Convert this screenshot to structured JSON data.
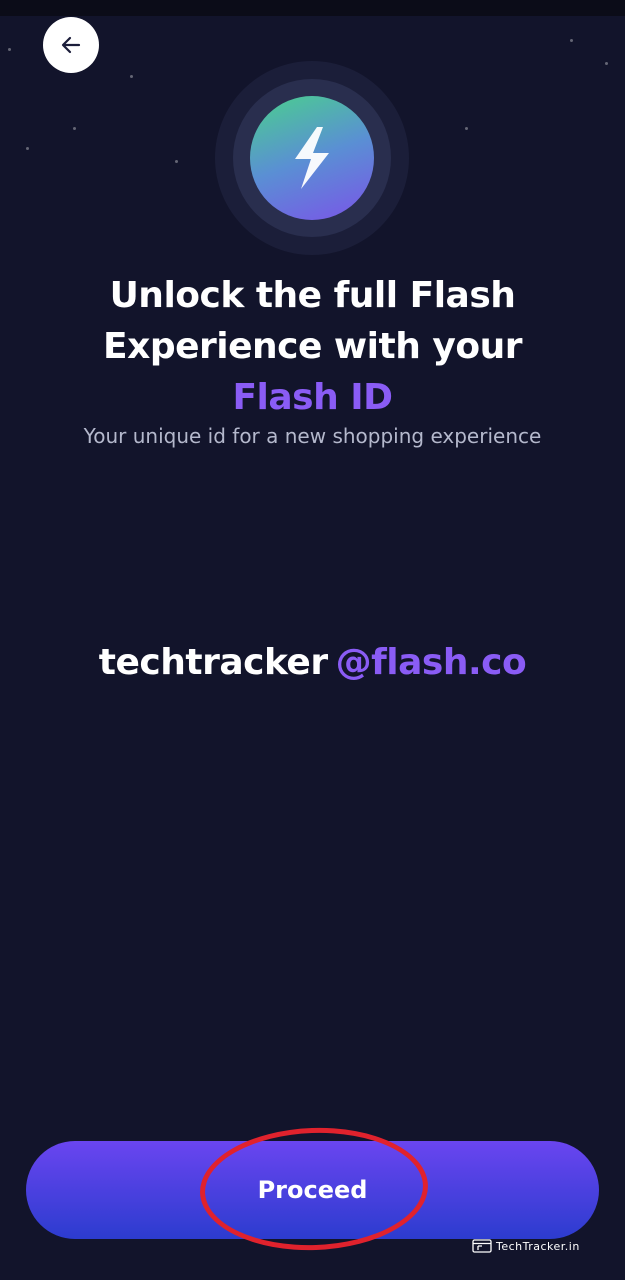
{
  "navigation": {
    "back_icon": "arrow-left-icon"
  },
  "hero": {
    "icon": "lightning-bolt-icon"
  },
  "headline": {
    "line1": "Unlock the full Flash",
    "line2": "Experience with your",
    "accent": "Flash ID"
  },
  "subtitle": "Your unique id for a new shopping experience",
  "flash_id": {
    "username": "techtracker",
    "domain": "@flash.co"
  },
  "actions": {
    "proceed_label": "Proceed"
  },
  "watermark": {
    "text": "TechTracker.in"
  },
  "colors": {
    "background": "#12142b",
    "accent": "#8a5cf5",
    "button_top": "#6a45f0",
    "button_bottom": "#2c3ccf",
    "annotation": "#e0222d"
  }
}
